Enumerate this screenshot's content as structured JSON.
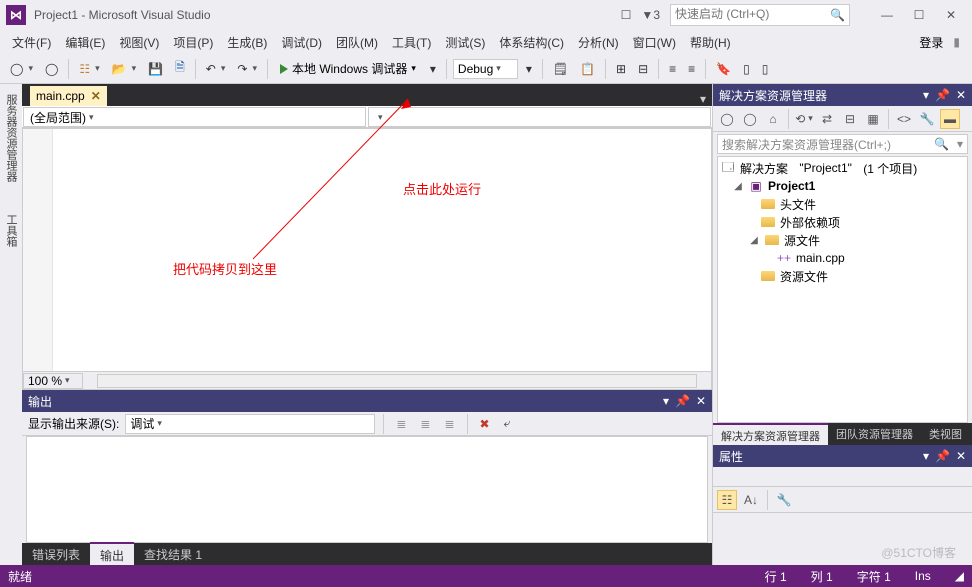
{
  "title": "Project1 - Microsoft Visual Studio",
  "notification_count": "3",
  "quicklaunch_placeholder": "快速启动 (Ctrl+Q)",
  "menu": {
    "file": "文件(F)",
    "edit": "编辑(E)",
    "view": "视图(V)",
    "project": "项目(P)",
    "build": "生成(B)",
    "debug": "调试(D)",
    "team": "团队(M)",
    "tools": "工具(T)",
    "test": "测试(S)",
    "arch": "体系结构(C)",
    "analyze": "分析(N)",
    "window": "窗口(W)",
    "help": "帮助(H)",
    "login": "登录"
  },
  "toolbar": {
    "debugger_label": "本地 Windows 调试器",
    "config": "Debug"
  },
  "editor": {
    "tab_name": "main.cpp",
    "scope": "(全局范围)",
    "zoom": "100 %",
    "annotation_run": "点击此处运行",
    "annotation_paste": "把代码拷贝到这里"
  },
  "output": {
    "title": "输出",
    "source_label": "显示输出来源(S):",
    "source_value": "调试"
  },
  "bottom_tabs": {
    "errors": "错误列表",
    "output": "输出",
    "find": "查找结果 1"
  },
  "solution_explorer": {
    "title": "解决方案资源管理器",
    "search_placeholder": "搜索解决方案资源管理器(Ctrl+;)",
    "solution_prefix": "解决方案",
    "solution_name": "\"Project1\"",
    "solution_suffix": "(1 个项目)",
    "project": "Project1",
    "headers": "头文件",
    "external": "外部依赖项",
    "sources": "源文件",
    "maincpp": "main.cpp",
    "resources": "资源文件"
  },
  "right_tabs": {
    "sln": "解决方案资源管理器",
    "team": "团队资源管理器",
    "class": "类视图"
  },
  "properties": {
    "title": "属性"
  },
  "status": {
    "ready": "就绪",
    "line_label": "行",
    "line": "1",
    "col_label": "列",
    "col": "1",
    "char_label": "字符",
    "char": "1",
    "ins": "Ins"
  },
  "watermark": "@51CTO博客"
}
